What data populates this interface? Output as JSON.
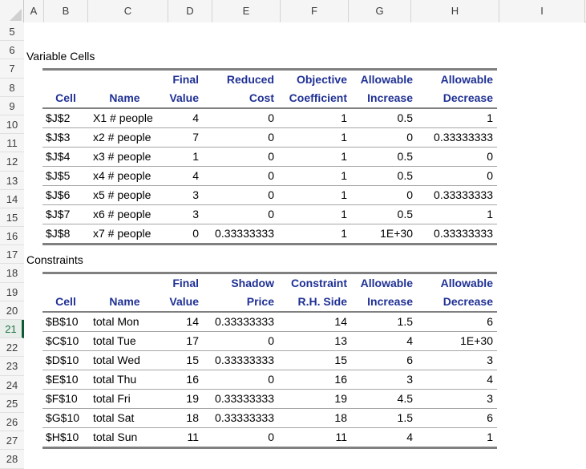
{
  "sheet": {
    "column_headers": [
      "A",
      "B",
      "C",
      "D",
      "E",
      "F",
      "G",
      "H",
      "I"
    ],
    "row_headers": [
      "5",
      "6",
      "7",
      "8",
      "9",
      "10",
      "11",
      "12",
      "13",
      "14",
      "15",
      "16",
      "17",
      "18",
      "19",
      "20",
      "21",
      "22",
      "23",
      "24",
      "25",
      "26",
      "27",
      "28"
    ],
    "active_row": "21",
    "header_color": "#1f3094",
    "active_row_color": "#217346",
    "grid_line_color": "#a6a6a6",
    "table_border_color": "#808080"
  },
  "variable_cells": {
    "title": "Variable Cells",
    "headers_top": [
      "",
      "",
      "Final",
      "Reduced",
      "Objective",
      "Allowable",
      "Allowable"
    ],
    "headers_bottom": [
      "Cell",
      "Name",
      "Value",
      "Cost",
      "Coefficient",
      "Increase",
      "Decrease"
    ],
    "rows": [
      {
        "cell": "$J$2",
        "name": "X1 #  people",
        "final_value": "4",
        "reduced_cost": "0",
        "objective_coefficient": "1",
        "allowable_increase": "0.5",
        "allowable_decrease": "1"
      },
      {
        "cell": "$J$3",
        "name": "x2 #  people",
        "final_value": "7",
        "reduced_cost": "0",
        "objective_coefficient": "1",
        "allowable_increase": "0",
        "allowable_decrease": "0.33333333"
      },
      {
        "cell": "$J$4",
        "name": "x3 #  people",
        "final_value": "1",
        "reduced_cost": "0",
        "objective_coefficient": "1",
        "allowable_increase": "0.5",
        "allowable_decrease": "0"
      },
      {
        "cell": "$J$5",
        "name": "x4 #  people",
        "final_value": "4",
        "reduced_cost": "0",
        "objective_coefficient": "1",
        "allowable_increase": "0.5",
        "allowable_decrease": "0"
      },
      {
        "cell": "$J$6",
        "name": "x5 #  people",
        "final_value": "3",
        "reduced_cost": "0",
        "objective_coefficient": "1",
        "allowable_increase": "0",
        "allowable_decrease": "0.33333333"
      },
      {
        "cell": "$J$7",
        "name": "x6 #  people",
        "final_value": "3",
        "reduced_cost": "0",
        "objective_coefficient": "1",
        "allowable_increase": "0.5",
        "allowable_decrease": "1"
      },
      {
        "cell": "$J$8",
        "name": "x7 #  people",
        "final_value": "0",
        "reduced_cost": "0.33333333",
        "objective_coefficient": "1",
        "allowable_increase": "1E+30",
        "allowable_decrease": "0.33333333"
      }
    ]
  },
  "constraints": {
    "title": "Constraints",
    "headers_top": [
      "",
      "",
      "Final",
      "Shadow",
      "Constraint",
      "Allowable",
      "Allowable"
    ],
    "headers_bottom": [
      "Cell",
      "Name",
      "Value",
      "Price",
      "R.H. Side",
      "Increase",
      "Decrease"
    ],
    "rows": [
      {
        "cell": "$B$10",
        "name": "total Mon",
        "final_value": "14",
        "shadow_price": "0.33333333",
        "rhs": "14",
        "allowable_increase": "1.5",
        "allowable_decrease": "6"
      },
      {
        "cell": "$C$10",
        "name": "total Tue",
        "final_value": "17",
        "shadow_price": "0",
        "rhs": "13",
        "allowable_increase": "4",
        "allowable_decrease": "1E+30"
      },
      {
        "cell": "$D$10",
        "name": "total Wed",
        "final_value": "15",
        "shadow_price": "0.33333333",
        "rhs": "15",
        "allowable_increase": "6",
        "allowable_decrease": "3"
      },
      {
        "cell": "$E$10",
        "name": "total Thu",
        "final_value": "16",
        "shadow_price": "0",
        "rhs": "16",
        "allowable_increase": "3",
        "allowable_decrease": "4"
      },
      {
        "cell": "$F$10",
        "name": "total Fri",
        "final_value": "19",
        "shadow_price": "0.33333333",
        "rhs": "19",
        "allowable_increase": "4.5",
        "allowable_decrease": "3"
      },
      {
        "cell": "$G$10",
        "name": "total Sat",
        "final_value": "18",
        "shadow_price": "0.33333333",
        "rhs": "18",
        "allowable_increase": "1.5",
        "allowable_decrease": "6"
      },
      {
        "cell": "$H$10",
        "name": "total Sun",
        "final_value": "11",
        "shadow_price": "0",
        "rhs": "11",
        "allowable_increase": "4",
        "allowable_decrease": "1"
      }
    ]
  }
}
